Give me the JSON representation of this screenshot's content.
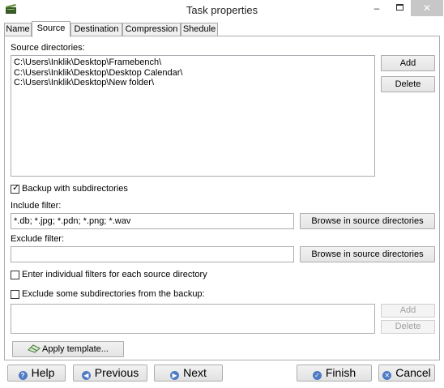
{
  "window": {
    "title": "Task properties",
    "minimize": "–",
    "close": "✕"
  },
  "tabs": [
    "Name",
    "Source",
    "Destination",
    "Compression",
    "Shedule"
  ],
  "source": {
    "directories_label": "Source directories:",
    "directories": [
      "C:\\Users\\Inklik\\Desktop\\Framebench\\",
      "C:\\Users\\Inklik\\Desktop\\Desktop Calendar\\",
      "C:\\Users\\Inklik\\Desktop\\New folder\\"
    ],
    "add_label": "Add",
    "delete_label": "Delete",
    "backup_subdirs_label": "Backup with subdirectories",
    "include_filter_label": "Include filter:",
    "include_filter_value": "*.db; *.jpg; *.pdn; *.png; *.wav",
    "browse_label": "Browse in source directories",
    "exclude_filter_label": "Exclude filter:",
    "exclude_filter_value": "",
    "individual_filters_label": "Enter individual filters for each source directory",
    "exclude_subdirs_label": "Exclude some subdirectories from the backup:",
    "exclude_add_label": "Add",
    "exclude_delete_label": "Delete",
    "apply_template_label": "Apply template..."
  },
  "footer": {
    "help_label": "Help",
    "previous_label": "Previous",
    "next_label": "Next",
    "finish_label": "Finish",
    "cancel_label": "Cancel"
  }
}
